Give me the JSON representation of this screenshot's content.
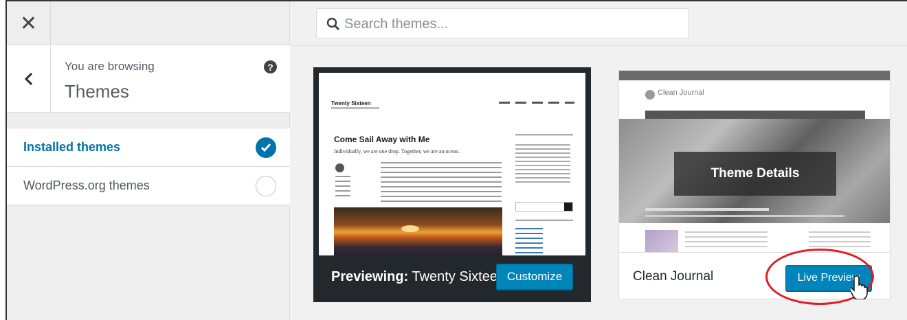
{
  "sidebar": {
    "close_icon": "close-icon",
    "back_icon": "chevron-left-icon",
    "help_icon": "help-icon",
    "browsing_label": "You are browsing",
    "browsing_title": "Themes",
    "filters": [
      {
        "label": "Installed themes",
        "selected": true
      },
      {
        "label": "WordPress.org themes",
        "selected": false
      }
    ]
  },
  "search": {
    "placeholder": "Search themes...",
    "value": ""
  },
  "themes": [
    {
      "name": "Twenty Sixteen",
      "prefix": "Previewing:",
      "action_label": "Customize",
      "screenshot": {
        "site_title": "Twenty Sixteen",
        "post_title": "Come Sail Away with Me",
        "post_subtitle": "Individually, we are one drop. Together, we are an ocean."
      }
    },
    {
      "name": "Clean Journal",
      "action_label": "Live Preview",
      "overlay_label": "Theme Details",
      "screenshot": {
        "site_title": "Clean Journal"
      }
    }
  ],
  "colors": {
    "accent": "#0073aa",
    "button": "#0085ba",
    "highlight": "#e01b24",
    "dark": "#23282d"
  }
}
